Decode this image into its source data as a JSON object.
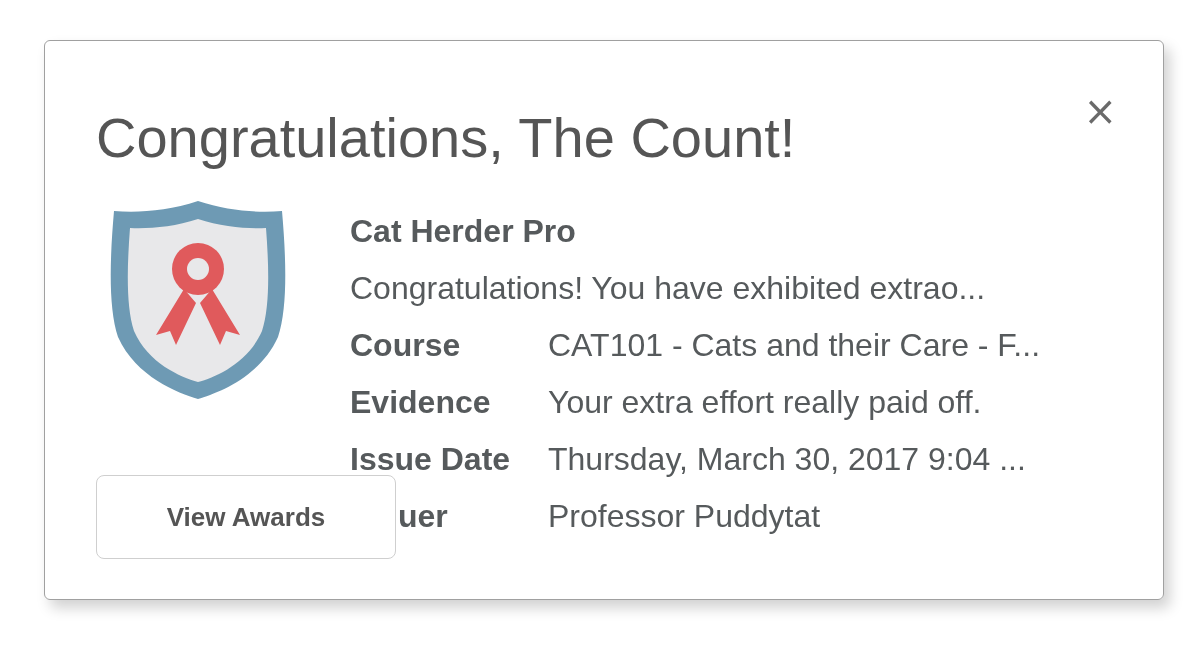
{
  "dialog": {
    "title": "Congratulations, The Count!",
    "close": "×"
  },
  "award": {
    "name": "Cat Herder Pro",
    "description": "Congratulations! You have exhibited extrao...",
    "fields": [
      {
        "label": "Course",
        "value": "CAT101 - Cats and their Care - F..."
      },
      {
        "label": "Evidence",
        "value": "Your extra effort really paid off."
      },
      {
        "label": "Issue Date",
        "value": "Thursday, March 30, 2017 9:04 ..."
      },
      {
        "label": "uer",
        "value": "Professor Puddytat"
      }
    ]
  },
  "button": "View Awards"
}
